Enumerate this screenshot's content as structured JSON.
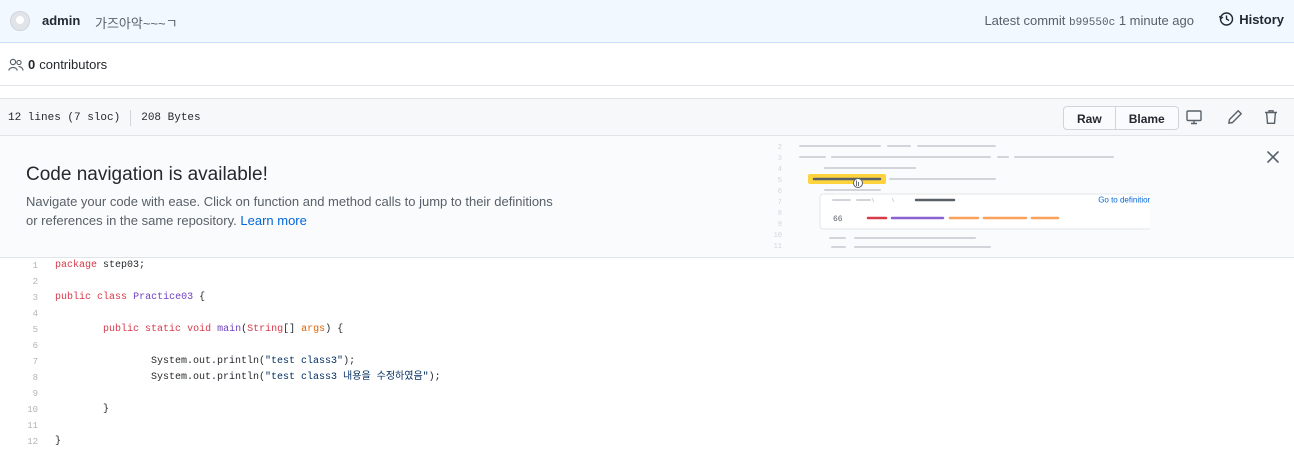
{
  "commit": {
    "author": "admin",
    "message": "가즈아악~~~ㄱ",
    "latest_label": "Latest commit",
    "sha": "b99550c",
    "time": "1 minute ago",
    "history_label": "History"
  },
  "contributors": {
    "count": "0",
    "label": "contributors"
  },
  "file_info": {
    "lines": "12 lines (7 sloc)",
    "size": "208 Bytes",
    "buttons": {
      "raw": "Raw",
      "blame": "Blame"
    }
  },
  "code_nav": {
    "title": "Code navigation is available!",
    "desc_line1": "Navigate your code with ease. Click on function and method calls to jump to their definitions",
    "desc_line2": "or references in the same repository.",
    "learn_more": "Learn more",
    "go_to_definition": "Go to definition",
    "ref_count": "66",
    "line_numbers": [
      "2",
      "3",
      "4",
      "5",
      "6",
      "7",
      "8",
      "9",
      "10",
      "11"
    ]
  },
  "icons": {
    "avatar": "avatar-icon",
    "history": "history-clock-icon",
    "contributors": "people-icon",
    "display": "desktop-icon",
    "edit": "pencil-icon",
    "delete": "trash-icon",
    "close": "close-icon"
  },
  "code_lines": [
    {
      "num": "1",
      "tokens": [
        [
          "kw",
          "package"
        ],
        [
          "",
          " step03;"
        ]
      ]
    },
    {
      "num": "2",
      "tokens": []
    },
    {
      "num": "3",
      "tokens": [
        [
          "kw",
          "public"
        ],
        [
          "",
          " "
        ],
        [
          "kw",
          "class"
        ],
        [
          "",
          " "
        ],
        [
          "fn",
          "Practice03"
        ],
        [
          "",
          " {"
        ]
      ]
    },
    {
      "num": "4",
      "tokens": []
    },
    {
      "num": "5",
      "tokens": [
        [
          "",
          "        "
        ],
        [
          "kw",
          "public"
        ],
        [
          "",
          " "
        ],
        [
          "kw",
          "static"
        ],
        [
          "",
          " "
        ],
        [
          "kw",
          "void"
        ],
        [
          "",
          " "
        ],
        [
          "fn",
          "main"
        ],
        [
          "",
          "("
        ],
        [
          "kw",
          "String"
        ],
        [
          "",
          "[] "
        ],
        [
          "pl",
          "args"
        ],
        [
          "",
          ") {"
        ]
      ]
    },
    {
      "num": "6",
      "tokens": []
    },
    {
      "num": "7",
      "tokens": [
        [
          "",
          "                System.out.println("
        ],
        [
          "str",
          "\"test class3\""
        ],
        [
          "",
          ");"
        ]
      ]
    },
    {
      "num": "8",
      "tokens": [
        [
          "",
          "                System.out.println("
        ],
        [
          "str",
          "\"test class3 내용을 수정하였음\""
        ],
        [
          "",
          ");"
        ]
      ]
    },
    {
      "num": "9",
      "tokens": []
    },
    {
      "num": "10",
      "tokens": [
        [
          "",
          "        }"
        ]
      ]
    },
    {
      "num": "11",
      "tokens": []
    },
    {
      "num": "12",
      "tokens": [
        [
          "",
          "}"
        ]
      ]
    }
  ],
  "colors": {
    "accent": "#0366d6",
    "commit_bg": "#f1f8ff",
    "highlight": "#ffd33d",
    "ref_red": "#d73a49",
    "ref_purple": "#8a63d2",
    "ref_orange": "#f9a05a"
  }
}
